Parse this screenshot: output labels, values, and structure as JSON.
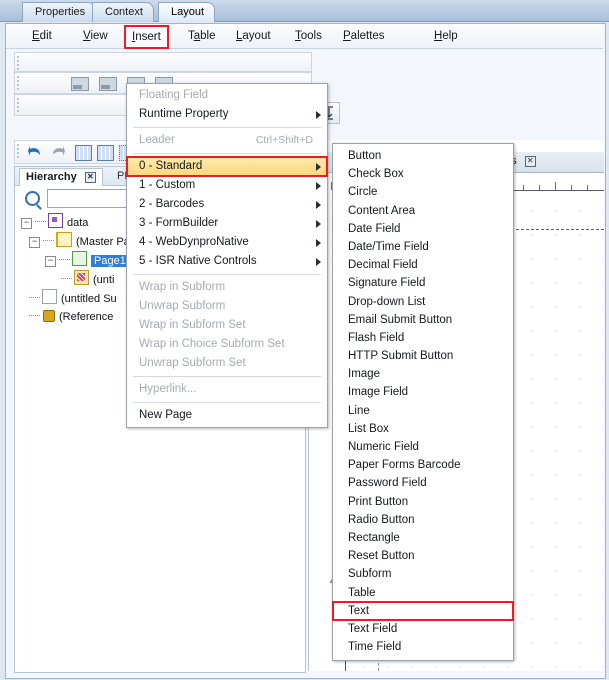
{
  "window": {
    "tabs": [
      {
        "label": "Properties",
        "active": false
      },
      {
        "label": "Context",
        "active": false
      },
      {
        "label": "Layout",
        "active": true
      }
    ]
  },
  "menubar": {
    "items": [
      {
        "label": "Edit",
        "mnemonic": "E",
        "highlighted": false
      },
      {
        "label": "View",
        "mnemonic": "V",
        "highlighted": false
      },
      {
        "label": "Insert",
        "mnemonic": "I",
        "highlighted": true
      },
      {
        "label": "Table",
        "mnemonic": "a",
        "highlighted": false
      },
      {
        "label": "Layout",
        "mnemonic": "L",
        "highlighted": false
      },
      {
        "label": "Tools",
        "mnemonic": "T",
        "highlighted": false
      },
      {
        "label": "Palettes",
        "mnemonic": "P",
        "highlighted": false
      },
      {
        "label": "Help",
        "mnemonic": "H",
        "highlighted": false
      }
    ]
  },
  "insert_menu": {
    "items": [
      {
        "label": "Floating Field",
        "disabled": true,
        "submenu": false,
        "shortcut": "",
        "highlighted": false
      },
      {
        "label": "Runtime Property",
        "disabled": false,
        "submenu": true,
        "shortcut": "",
        "highlighted": false
      },
      {
        "separator_after": true,
        "label": "Leader",
        "disabled": true,
        "submenu": false,
        "shortcut": "Ctrl+Shift+D",
        "highlighted": false
      },
      {
        "label": "0 - Standard",
        "disabled": false,
        "submenu": true,
        "shortcut": "",
        "highlighted": true
      },
      {
        "label": "1 - Custom",
        "disabled": false,
        "submenu": true,
        "shortcut": "",
        "highlighted": false
      },
      {
        "label": "2 - Barcodes",
        "disabled": false,
        "submenu": true,
        "shortcut": "",
        "highlighted": false
      },
      {
        "label": "3 - FormBuilder",
        "disabled": false,
        "submenu": true,
        "shortcut": "",
        "highlighted": false
      },
      {
        "label": "4 - WebDynproNative",
        "disabled": false,
        "submenu": true,
        "shortcut": "",
        "highlighted": false
      },
      {
        "label": "5 - ISR Native Controls",
        "disabled": false,
        "submenu": true,
        "shortcut": "",
        "highlighted": false
      },
      {
        "label": "Wrap in Subform",
        "disabled": true,
        "submenu": false,
        "shortcut": "",
        "highlighted": false
      },
      {
        "label": "Unwrap Subform",
        "disabled": true,
        "submenu": false,
        "shortcut": "",
        "highlighted": false
      },
      {
        "label": "Wrap in Subform Set",
        "disabled": true,
        "submenu": false,
        "shortcut": "",
        "highlighted": false
      },
      {
        "label": "Wrap in Choice Subform Set",
        "disabled": true,
        "submenu": false,
        "shortcut": "",
        "highlighted": false
      },
      {
        "label": "Unwrap Subform Set",
        "disabled": true,
        "submenu": false,
        "shortcut": "",
        "highlighted": false
      },
      {
        "label": "Hyperlink...",
        "disabled": true,
        "submenu": false,
        "shortcut": "",
        "highlighted": false
      },
      {
        "label": "New Page",
        "disabled": false,
        "submenu": false,
        "shortcut": "",
        "highlighted": false
      }
    ]
  },
  "standard_submenu": {
    "items": [
      {
        "label": "Button",
        "highlighted": false
      },
      {
        "label": "Check Box",
        "highlighted": false
      },
      {
        "label": "Circle",
        "highlighted": false
      },
      {
        "label": "Content Area",
        "highlighted": false
      },
      {
        "label": "Date Field",
        "highlighted": false
      },
      {
        "label": "Date/Time Field",
        "highlighted": false
      },
      {
        "label": "Decimal Field",
        "highlighted": false
      },
      {
        "label": "Signature Field",
        "highlighted": false
      },
      {
        "label": "Drop-down List",
        "highlighted": false
      },
      {
        "label": "Email Submit Button",
        "highlighted": false
      },
      {
        "label": "Flash Field",
        "highlighted": false
      },
      {
        "label": "HTTP Submit Button",
        "highlighted": false
      },
      {
        "label": "Image",
        "highlighted": false
      },
      {
        "label": "Image Field",
        "highlighted": false
      },
      {
        "label": "Line",
        "highlighted": false
      },
      {
        "label": "List Box",
        "highlighted": false
      },
      {
        "label": "Numeric Field",
        "highlighted": false
      },
      {
        "label": "Paper Forms Barcode",
        "highlighted": false
      },
      {
        "label": "Password Field",
        "highlighted": false
      },
      {
        "label": "Print Button",
        "highlighted": false
      },
      {
        "label": "Radio Button",
        "highlighted": false
      },
      {
        "label": "Rectangle",
        "highlighted": false
      },
      {
        "label": "Reset Button",
        "highlighted": false
      },
      {
        "label": "Subform",
        "highlighted": false
      },
      {
        "label": "Table",
        "highlighted": false
      },
      {
        "label": "Text",
        "highlighted": true
      },
      {
        "label": "Text Field",
        "highlighted": false
      },
      {
        "label": "Time Field",
        "highlighted": false
      }
    ]
  },
  "hierarchy_panel": {
    "tabs": [
      {
        "label": "Hierarchy",
        "active": true,
        "closable": true
      },
      {
        "label": "PDF",
        "active": false,
        "closable": false
      }
    ],
    "search_value": "",
    "search_placeholder": "",
    "tree": [
      {
        "label": "data",
        "level": 0,
        "icon": "data-node-icon",
        "expanded": true,
        "selected": false
      },
      {
        "label": "(Master Pa",
        "level": 1,
        "icon": "master-page-icon",
        "expanded": true,
        "selected": false
      },
      {
        "label": "Page1",
        "level": 2,
        "icon": "page-icon",
        "expanded": true,
        "selected": true
      },
      {
        "label": "(unti",
        "level": 3,
        "icon": "field-icon",
        "expanded": false,
        "selected": false
      },
      {
        "label": "(untitled Su",
        "level": 1,
        "icon": "subform-icon",
        "expanded": false,
        "selected": false
      },
      {
        "label": "(Reference",
        "level": 1,
        "icon": "reference-icon",
        "expanded": false,
        "selected": false
      }
    ]
  },
  "layout_canvas": {
    "tab_label": "es",
    "h_ruler_labels": [
      "2"
    ],
    "v_ruler_labels": [
      "4"
    ]
  },
  "colors": {
    "highlight_red": "#ec1c24",
    "menu_highlight_gold": "#fcd878",
    "selection_blue": "#2f7fd4",
    "tab_active": "#ffffff"
  }
}
